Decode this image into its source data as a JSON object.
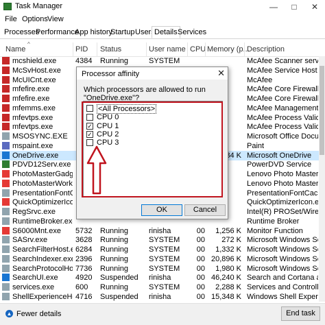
{
  "window": {
    "title": "Task Manager",
    "minimize": "—",
    "maximize": "□",
    "close": "✕"
  },
  "menu": [
    "File",
    "Options",
    "View"
  ],
  "tabs": [
    "Processes",
    "Performance",
    "App history",
    "Startup",
    "Users",
    "Details",
    "Services"
  ],
  "active_tab": "Details",
  "columns": [
    "Name",
    "PID",
    "Status",
    "User name",
    "CPU",
    "Memory (p...",
    "Description"
  ],
  "rows": [
    {
      "icon": "mcafee-icon",
      "color": "#c62828",
      "name": "mcshield.exe",
      "pid": "4384",
      "status": "Running",
      "user": "SYSTEM",
      "cpu": "",
      "mem": "",
      "desc": "McAfee Scanner service"
    },
    {
      "icon": "mcafee-icon",
      "color": "#c62828",
      "name": "McSvHost.exe",
      "pid": "",
      "status": "",
      "user": "",
      "cpu": "",
      "mem": "",
      "desc": "McAfee Service Host"
    },
    {
      "icon": "mcafee-icon",
      "color": "#c62828",
      "name": "McUICnt.exe",
      "pid": "",
      "status": "",
      "user": "",
      "cpu": "",
      "mem": "",
      "desc": "McAfee"
    },
    {
      "icon": "mcafee-icon",
      "color": "#c62828",
      "name": "mfefire.exe",
      "pid": "",
      "status": "",
      "user": "",
      "cpu": "",
      "mem": "",
      "desc": "McAfee Core Firewall Se..."
    },
    {
      "icon": "mcafee-icon",
      "color": "#c62828",
      "name": "mfefire.exe",
      "pid": "",
      "status": "",
      "user": "",
      "cpu": "",
      "mem": "",
      "desc": "McAfee Core Firewall Se..."
    },
    {
      "icon": "mcafee-icon",
      "color": "#c62828",
      "name": "mfemms.exe",
      "pid": "",
      "status": "",
      "user": "",
      "cpu": "",
      "mem": "",
      "desc": "McAfee Management S..."
    },
    {
      "icon": "mcafee-icon",
      "color": "#c62828",
      "name": "mfevtps.exe",
      "pid": "",
      "status": "",
      "user": "",
      "cpu": "",
      "mem": "",
      "desc": "McAfee Process Validati..."
    },
    {
      "icon": "mcafee-icon",
      "color": "#c62828",
      "name": "mfevtps.exe",
      "pid": "",
      "status": "",
      "user": "",
      "cpu": "",
      "mem": "",
      "desc": "McAfee Process Validati..."
    },
    {
      "icon": "app-icon",
      "color": "#90a4ae",
      "name": "MSOSYNC.EXE",
      "pid": "",
      "status": "",
      "user": "",
      "cpu": "",
      "mem": "",
      "desc": "Microsoft Office Docu..."
    },
    {
      "icon": "paint-icon",
      "color": "#5c6bc0",
      "name": "mspaint.exe",
      "pid": "",
      "status": "",
      "user": "",
      "cpu": "",
      "mem": "",
      "desc": "Paint"
    },
    {
      "icon": "cloud-icon",
      "color": "#1976d2",
      "name": "OneDrive.exe",
      "pid": "",
      "status": "",
      "user": "",
      "cpu": "",
      "mem": "384 K",
      "desc": "Microsoft OneDrive",
      "selected": true
    },
    {
      "icon": "pdvd-icon",
      "color": "#2e7d32",
      "name": "PDVD12Serv.exe",
      "pid": "",
      "status": "",
      "user": "",
      "cpu": "",
      "mem": "",
      "desc": "PowerDVD Service"
    },
    {
      "icon": "photo-icon",
      "color": "#e53935",
      "name": "PhotoMasterGadget...",
      "pid": "",
      "status": "",
      "user": "",
      "cpu": "",
      "mem": "",
      "desc": "Lenovo Photo Master"
    },
    {
      "icon": "photo-icon",
      "color": "#e53935",
      "name": "PhotoMasterWorker....",
      "pid": "",
      "status": "",
      "user": "",
      "cpu": "",
      "mem": "",
      "desc": "Lenovo Photo Master"
    },
    {
      "icon": "app-icon",
      "color": "#90a4ae",
      "name": "PresentationFontCac...",
      "pid": "",
      "status": "",
      "user": "",
      "cpu": "",
      "mem": "",
      "desc": "PresentationFontCache..."
    },
    {
      "icon": "optimizer-icon",
      "color": "#e53935",
      "name": "QuickOptimizerIcon....",
      "pid": "",
      "status": "",
      "user": "",
      "cpu": "",
      "mem": "",
      "desc": "QuickOptimizerIcon.exe"
    },
    {
      "icon": "app-icon",
      "color": "#90a4ae",
      "name": "RegSrvc.exe",
      "pid": "",
      "status": "",
      "user": "",
      "cpu": "",
      "mem": "",
      "desc": "Intel(R) PROSet/Wireless..."
    },
    {
      "icon": "app-icon",
      "color": "#90a4ae",
      "name": "RuntimeBroker.exe",
      "pid": "",
      "status": "",
      "user": "",
      "cpu": "",
      "mem": "",
      "desc": "Runtime Broker"
    },
    {
      "icon": "monitor-icon",
      "color": "#e53935",
      "name": "S6000Mnt.exe",
      "pid": "5732",
      "status": "Running",
      "user": "rinisha",
      "cpu": "00",
      "mem": "1,256 K",
      "desc": "Monitor Function"
    },
    {
      "icon": "app-icon",
      "color": "#90a4ae",
      "name": "SASrv.exe",
      "pid": "3628",
      "status": "Running",
      "user": "SYSTEM",
      "cpu": "00",
      "mem": "272 K",
      "desc": "Microsoft Windows Ser..."
    },
    {
      "icon": "search-icon",
      "color": "#90a4ae",
      "name": "SearchFilterHost.exe",
      "pid": "6284",
      "status": "Running",
      "user": "SYSTEM",
      "cpu": "00",
      "mem": "1,332 K",
      "desc": "Microsoft Windows Sear..."
    },
    {
      "icon": "search-icon",
      "color": "#90a4ae",
      "name": "SearchIndexer.exe",
      "pid": "2396",
      "status": "Running",
      "user": "SYSTEM",
      "cpu": "00",
      "mem": "20,896 K",
      "desc": "Microsoft Windows Sear..."
    },
    {
      "icon": "search-icon",
      "color": "#90a4ae",
      "name": "SearchProtocolHost...",
      "pid": "7736",
      "status": "Running",
      "user": "SYSTEM",
      "cpu": "00",
      "mem": "1,980 K",
      "desc": "Microsoft Windows Sear..."
    },
    {
      "icon": "search-icon",
      "color": "#1976d2",
      "name": "SearchUI.exe",
      "pid": "4920",
      "status": "Suspended",
      "user": "rinisha",
      "cpu": "00",
      "mem": "46,240 K",
      "desc": "Search and Cortana app..."
    },
    {
      "icon": "app-icon",
      "color": "#90a4ae",
      "name": "services.exe",
      "pid": "600",
      "status": "Running",
      "user": "SYSTEM",
      "cpu": "00",
      "mem": "2,288 K",
      "desc": "Services and Controller ..."
    },
    {
      "icon": "app-icon",
      "color": "#90a4ae",
      "name": "ShellExperienceHost...",
      "pid": "4716",
      "status": "Suspended",
      "user": "rinisha",
      "cpu": "00",
      "mem": "15,348 K",
      "desc": "Windows Shell Experien..."
    }
  ],
  "footer": {
    "fewer_details": "Fewer details",
    "end_task": "End task"
  },
  "dialog": {
    "title": "Processor affinity",
    "question": "Which processors are allowed to run \"OneDrive.exe\"?",
    "options": [
      {
        "label": "<All Processors>",
        "checked": false
      },
      {
        "label": "CPU 0",
        "checked": false
      },
      {
        "label": "CPU 1",
        "checked": true
      },
      {
        "label": "CPU 2",
        "checked": true
      },
      {
        "label": "CPU 3",
        "checked": false
      }
    ],
    "ok": "OK",
    "cancel": "Cancel",
    "close": "✕"
  },
  "colors": {
    "selection": "#cce8ff",
    "highlight": "#c0141e",
    "accent": "#0078d7"
  }
}
